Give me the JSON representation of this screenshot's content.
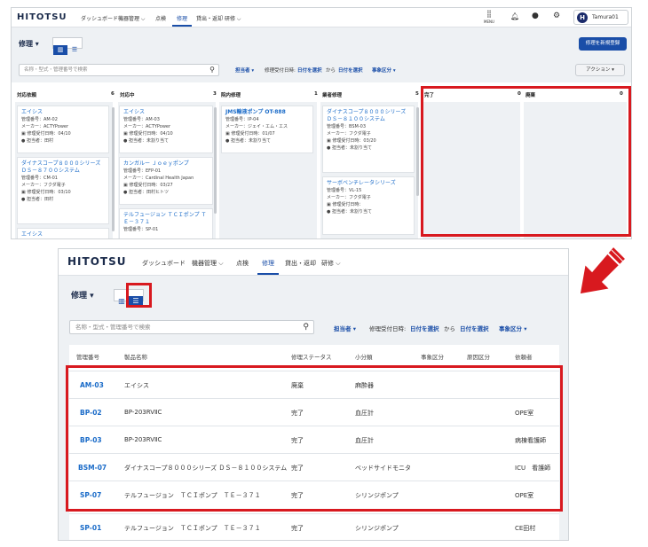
{
  "top": {
    "logo": "HITOTSU",
    "nav": [
      "ダッシュボード",
      "機器管理 ⌵",
      "点検",
      "修理",
      "貸出・返却",
      "研修 ⌵"
    ],
    "menu_label": "MENU",
    "user": "Tamura01",
    "avatar": "H",
    "page_title": "修理 ▾",
    "new_button": "修理を新規登録",
    "search_placeholder": "名称・型式・管理番号で検索",
    "filter_owner": "担当者 ▾",
    "filter_date_label": "修理受付日時:",
    "filter_from": "日付を選択",
    "filter_to_word": "から",
    "filter_to": "日付を選択",
    "filter_type": "事象区分 ▾",
    "action_button": "アクション ▾",
    "columns": [
      {
        "name": "対応依頼",
        "count": "6",
        "cards": [
          {
            "title": "エイシス",
            "lines": [
              "管理番号：AM-02",
              "メーカー：ACTYPower",
              "修理受付日時：04/10",
              "担当者：田村"
            ]
          },
          {
            "title": "ダイナスコープ８０００シリーズ ＤＳ－８７００システム",
            "lines": [
              "管理番号：CM-01",
              "メーカー：フクダ電子",
              "修理受付日時：03/10",
              "担当者：田村"
            ]
          },
          {
            "title": "エイシス",
            "lines": []
          }
        ]
      },
      {
        "name": "対応中",
        "count": "3",
        "cards": [
          {
            "title": "エイシス",
            "lines": [
              "管理番号：AM-03",
              "メーカー：ACTYPower",
              "修理受付日時：04/10",
              "担当者：未割り当て"
            ]
          },
          {
            "title": "カンガルー Ｊｏｅｙポンプ",
            "lines": [
              "管理番号：EFP-01",
              "メーカー：Cardinal Health Japan",
              "修理受付日時：03/27",
              "担当者：田村ヒトツ"
            ]
          },
          {
            "title": "テルフュージョン ＴＣＩポンプ ＴＥ－３７１",
            "lines": [
              "管理番号：SP-01"
            ]
          }
        ]
      },
      {
        "name": "院内修理",
        "count": "1",
        "cards": [
          {
            "title": "JMS輸液ポンプ OT-888",
            "lines": [
              "管理番号：IP-04",
              "メーカー：ジェイ・エム・エス",
              "修理受付日時：01/07",
              "担当者：未割り当て"
            ]
          }
        ]
      },
      {
        "name": "業者修理",
        "count": "5",
        "cards": [
          {
            "title": "ダイナスコープ８０００シリーズ ＤＳ－８１００システム",
            "lines": [
              "管理番号：BSM-03",
              "メーカー：フクダ電子",
              "修理受付日時：03/20",
              "担当者：未割り当て"
            ]
          },
          {
            "title": "サーボベンチレータシリーズ",
            "lines": [
              "管理番号：VL-15",
              "メーカー：フクダ電子",
              "修理受付日時：",
              "担当者：未割り当て"
            ]
          }
        ]
      },
      {
        "name": "完了",
        "count": "0",
        "cards": []
      },
      {
        "name": "廃棄",
        "count": "0",
        "cards": []
      }
    ]
  },
  "bottom": {
    "logo": "HITOTSU",
    "nav": [
      "ダッシュボード",
      "機器管理 ⌵",
      "点検",
      "修理",
      "貸出・返却",
      "研修 ⌵"
    ],
    "page_title": "修理 ▾",
    "search_placeholder": "名称・型式・管理番号で検索",
    "filter_owner": "担当者 ▾",
    "filter_date_label": "修理受付日時:",
    "filter_from": "日付を選択",
    "filter_to_word": "から",
    "filter_to": "日付を選択",
    "filter_type": "事象区分 ▾",
    "headers": [
      "管理番号",
      "製品名称",
      "修理ステータス",
      "小分類",
      "事象区分",
      "原因区分",
      "依頼者"
    ],
    "rows": [
      {
        "code": "AM-03",
        "name": "エイシス",
        "status": "廃棄",
        "category": "麻酔器",
        "requester": ""
      },
      {
        "code": "BP-02",
        "name": "BP-203RVⅡC",
        "status": "完了",
        "category": "血圧計",
        "requester": "OPE室"
      },
      {
        "code": "BP-03",
        "name": "BP-203RVⅡC",
        "status": "完了",
        "category": "血圧計",
        "requester": "病棟看護師"
      },
      {
        "code": "BSM-07",
        "name": "ダイナスコープ８０００シリーズ ＤＳ－８１００システム",
        "status": "完了",
        "category": "ベッドサイドモニタ",
        "requester": "ICU　看護師"
      },
      {
        "code": "SP-07",
        "name": "テルフュージョン　ＴＣＩポンプ　ＴＥ－３７１",
        "status": "完了",
        "category": "シリンジポンプ",
        "requester": "OPE室"
      },
      {
        "code": "SP-01",
        "name": "テルフュージョン　ＴＣＩポンプ　ＴＥ－３７１",
        "status": "完了",
        "category": "シリンジポンプ",
        "requester": "CE田村"
      }
    ]
  },
  "colors": {
    "accent": "#1a4ea8",
    "highlight": "#d8191f",
    "link": "#1a6bc8"
  }
}
